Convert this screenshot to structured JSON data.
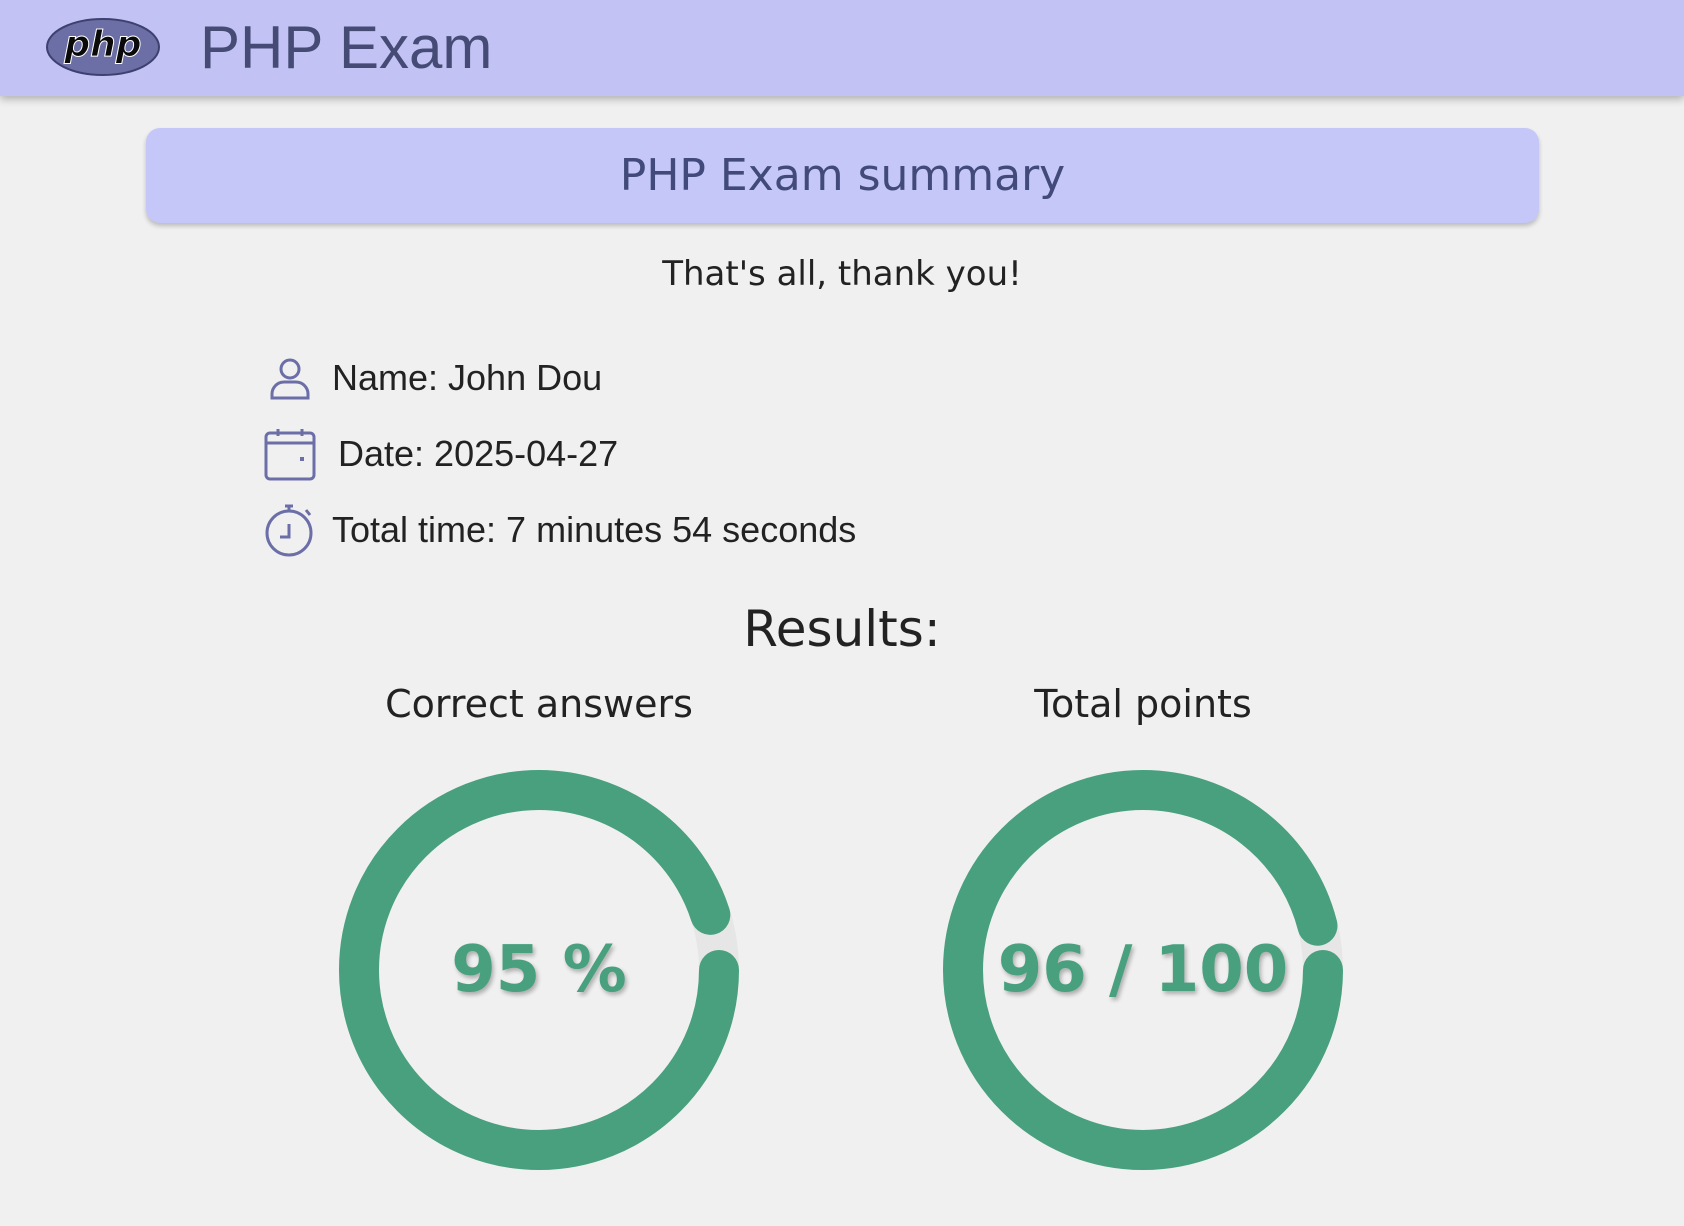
{
  "header": {
    "logo_text": "php",
    "title": "PHP Exam"
  },
  "summary": {
    "title": "PHP Exam summary",
    "message": "That's all, thank you!"
  },
  "info": {
    "name": "Name: John Dou",
    "date": "Date: 2025-04-27",
    "total_time": "Total time: 7 minutes 54 seconds"
  },
  "results": {
    "heading": "Results:",
    "correct": {
      "label": "Correct answers",
      "display": "95 %",
      "fraction": 0.95
    },
    "points": {
      "label": "Total points",
      "display": "96 / 100",
      "fraction": 0.96
    }
  },
  "colors": {
    "header_bg": "#c2c3f4",
    "banner_bg": "#c5c7f8",
    "accent_green": "#48a07e",
    "icon_purple": "#6c6ea8",
    "page_bg": "#f0f0f0"
  },
  "icons": {
    "logo": "php-logo",
    "name": "user-icon",
    "date": "calendar-icon",
    "time": "stopwatch-icon"
  }
}
